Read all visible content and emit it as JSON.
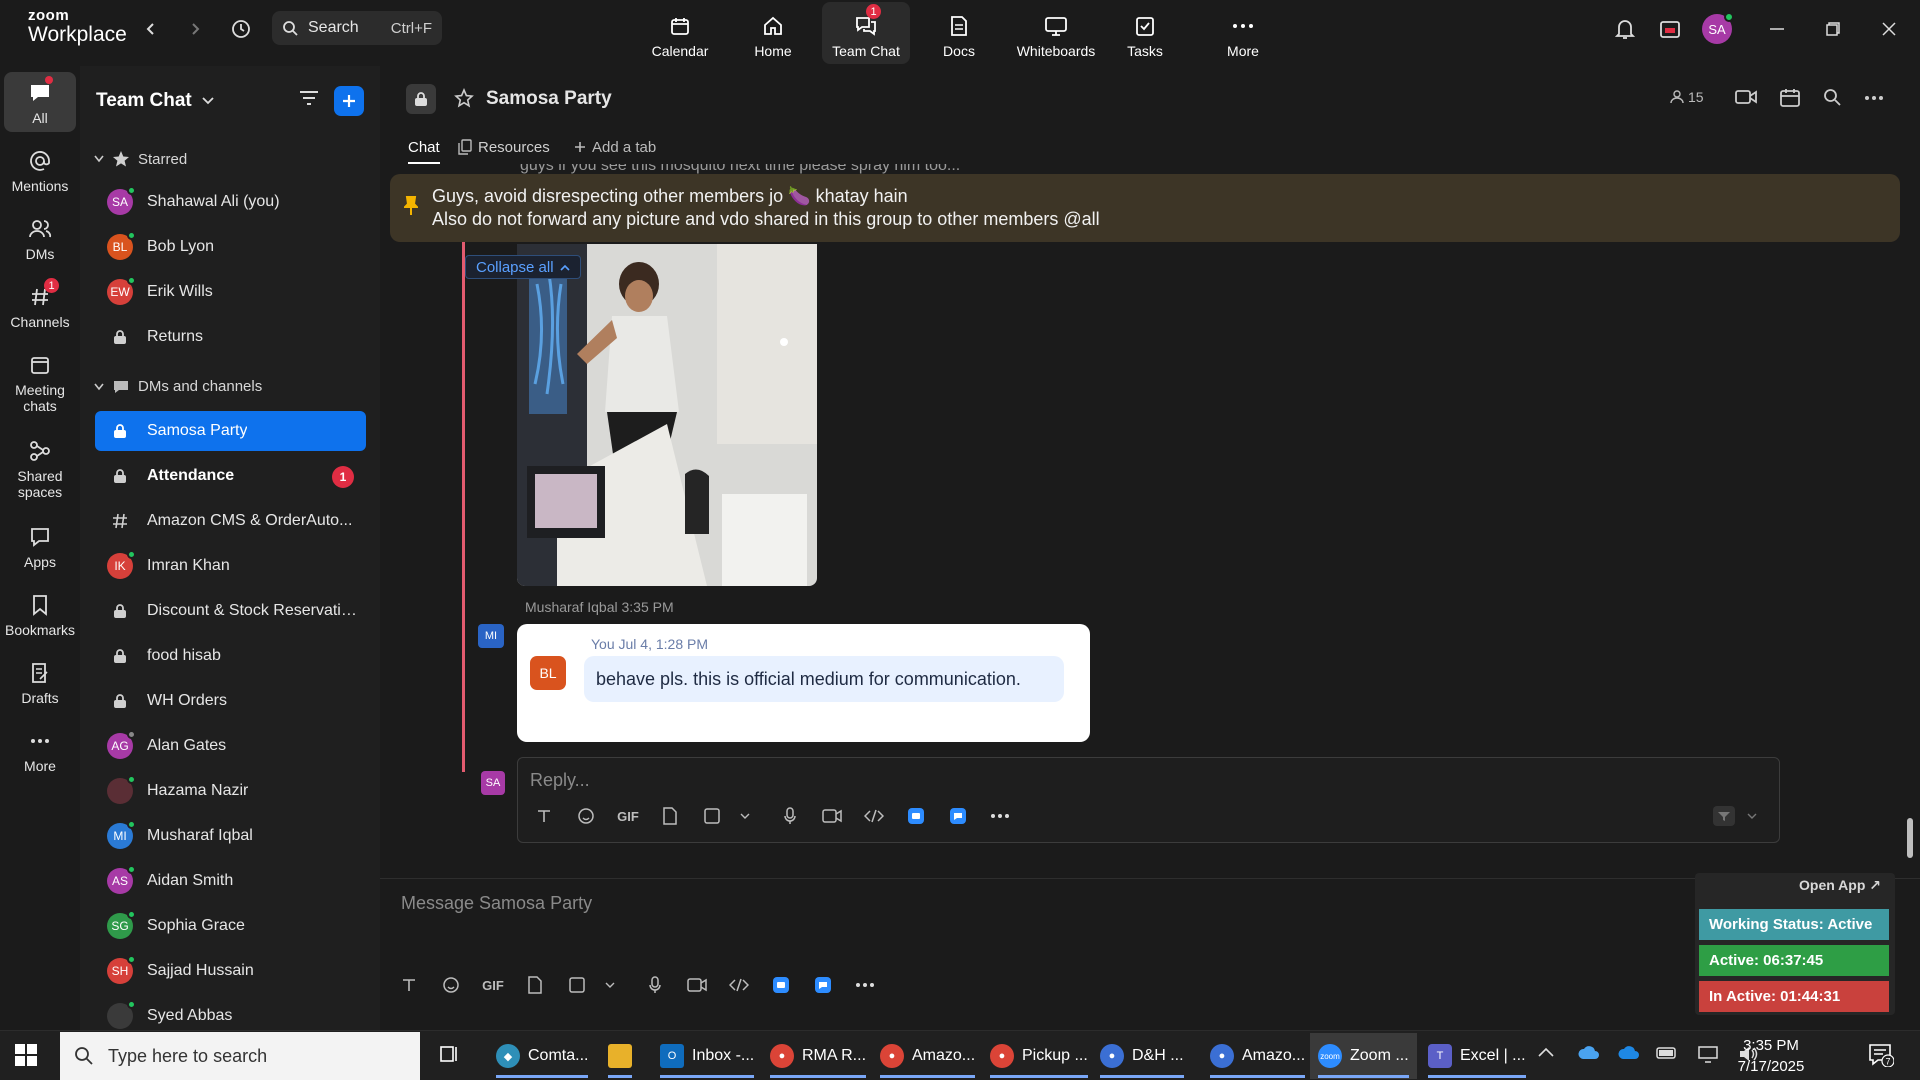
{
  "app": {
    "logo_top": "zoom",
    "logo_bottom": "Workplace"
  },
  "search": {
    "placeholder": "Search",
    "shortcut": "Ctrl+F"
  },
  "nav_tabs": [
    {
      "label": "Calendar"
    },
    {
      "label": "Home"
    },
    {
      "label": "Team Chat",
      "badge": "1"
    },
    {
      "label": "Docs"
    },
    {
      "label": "Whiteboards"
    },
    {
      "label": "Tasks"
    },
    {
      "label": "More"
    }
  ],
  "user": {
    "initials": "SA"
  },
  "rail": [
    {
      "label": "All"
    },
    {
      "label": "Mentions"
    },
    {
      "label": "DMs"
    },
    {
      "label": "Channels",
      "badge": "1"
    },
    {
      "label": "Meeting chats"
    },
    {
      "label": "Shared spaces"
    },
    {
      "label": "Apps"
    },
    {
      "label": "Bookmarks"
    },
    {
      "label": "Drafts"
    },
    {
      "label": "More"
    }
  ],
  "sidebar": {
    "title": "Team Chat",
    "starred_label": "Starred",
    "dms_label": "DMs and channels",
    "starred": [
      {
        "name": "Shahawal Ali (you)",
        "initials": "SA",
        "color": "#a73aa6"
      },
      {
        "name": "Bob Lyon",
        "initials": "BL",
        "color": "#d9531e"
      },
      {
        "name": "Erik Wills",
        "initials": "EW",
        "color": "#d6403a"
      },
      {
        "name": "Returns"
      }
    ],
    "channels": [
      {
        "name": "Samosa Party"
      },
      {
        "name": "Attendance",
        "badge": "1"
      },
      {
        "name": "Amazon CMS & OrderAuto..."
      },
      {
        "name": "Imran Khan",
        "initials": "IK",
        "color": "#d6403a"
      },
      {
        "name": "Discount & Stock Reservatio..."
      },
      {
        "name": "food hisab"
      },
      {
        "name": "WH Orders"
      },
      {
        "name": "Alan Gates",
        "initials": "AG",
        "color": "#a73aa6"
      },
      {
        "name": "Hazama Nazir",
        "initials": "",
        "color": "#5a2e35"
      },
      {
        "name": "Musharaf Iqbal",
        "initials": "MI",
        "color": "#2a7ad5"
      },
      {
        "name": "Aidan Smith",
        "initials": "AS",
        "color": "#a73aa6"
      },
      {
        "name": "Sophia Grace",
        "initials": "SG",
        "color": "#2f9a4a"
      },
      {
        "name": "Sajjad Hussain",
        "initials": "SH",
        "color": "#d6403a"
      },
      {
        "name": "Syed Abbas",
        "initials": "",
        "color": "#3a3a3a"
      }
    ]
  },
  "channel": {
    "title": "Samosa Party",
    "member_count": "15",
    "tabs": {
      "chat": "Chat",
      "resources": "Resources",
      "add": "Add a tab"
    }
  },
  "feed": {
    "cut_text": "guys if you see this mosquito next time please spray him too...",
    "pinned_line1": "Guys, avoid disrespecting other members jo 🍆 khatay hain",
    "pinned_line2": "Also do not forward any picture and vdo shared in this group to other members @all",
    "collapse_label": "Collapse all",
    "sender": "Musharaf Iqbal",
    "time": "3:35 PM",
    "sender_initials": "MI",
    "quote_meta": "You Jul 4, 1:28 PM",
    "quote_initials": "BL",
    "quote_text": "behave pls. this is official medium for communication.",
    "my_initials": "SA",
    "reply_placeholder": "Reply...",
    "gif": "GIF"
  },
  "composer": {
    "placeholder": "Message Samosa Party"
  },
  "widget": {
    "open_app": "Open App ↗",
    "working": "Working Status: Active",
    "active": "Active: 06:37:45",
    "inactive": "In Active: 01:44:31",
    "colors": {
      "working": "#3f9aa3",
      "active": "#2e9e45",
      "inactive": "#c9413d"
    }
  },
  "taskbar": {
    "search_placeholder": "Type here to search",
    "apps": [
      {
        "label": "Comta..."
      },
      {
        "label": ""
      },
      {
        "label": "Inbox -..."
      },
      {
        "label": "RMA R..."
      },
      {
        "label": "Amazo..."
      },
      {
        "label": "Pickup ..."
      },
      {
        "label": "D&H ..."
      },
      {
        "label": "Amazo..."
      },
      {
        "label": "Zoom ..."
      },
      {
        "label": "Excel | ..."
      }
    ],
    "time": "3:35 PM",
    "date": "7/17/2025",
    "notif_count": "7"
  }
}
